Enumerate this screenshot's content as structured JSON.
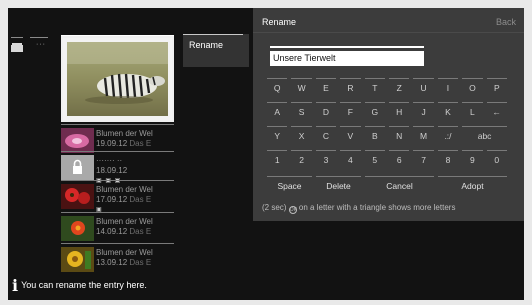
{
  "menu": {
    "rename_label": "Rename"
  },
  "dialog": {
    "title": "Rename",
    "back_label": "Back",
    "input_value": "Unsere Tierwelt",
    "rows": [
      [
        "Q",
        "W",
        "E",
        "R",
        "T",
        "Z",
        "U",
        "I",
        "O",
        "P"
      ],
      [
        "A",
        "S",
        "D",
        "F",
        "G",
        "H",
        "J",
        "K",
        "L",
        "←"
      ],
      [
        "Y",
        "X",
        "C",
        "V",
        "B",
        "N",
        "M",
        ".:/",
        "abc"
      ],
      [
        "1",
        "2",
        "3",
        "4",
        "5",
        "6",
        "7",
        "8",
        "9",
        "0"
      ]
    ],
    "actions": {
      "space": "Space",
      "delete": "Delete",
      "cancel": "Cancel",
      "adopt": "Adopt"
    },
    "footer": {
      "pre": "(2 sec)",
      "post": "on a letter with a triangle shows more letters"
    }
  },
  "recordings": [
    {
      "title": "Blumen der Wel",
      "date": "19.09.12",
      "sub": "Das E"
    },
    {
      "title": "······· ··",
      "date": "18.09.12",
      "sub": "",
      "locked": true
    },
    {
      "title": "Blumen der Wel",
      "date": "17.09.12",
      "sub": "Das E"
    },
    {
      "title": "Blumen der Wel",
      "date": "14.09.12",
      "sub": "Das E"
    },
    {
      "title": "Blumen der Wel",
      "date": "13.09.12",
      "sub": "Das E"
    }
  ],
  "hint": {
    "text": "You can rename the entry here."
  },
  "colors": {
    "background": "#121212",
    "dialog": "#3c3c3c",
    "menu_tab": "#333333",
    "text_dim": "#9a9a9a"
  }
}
